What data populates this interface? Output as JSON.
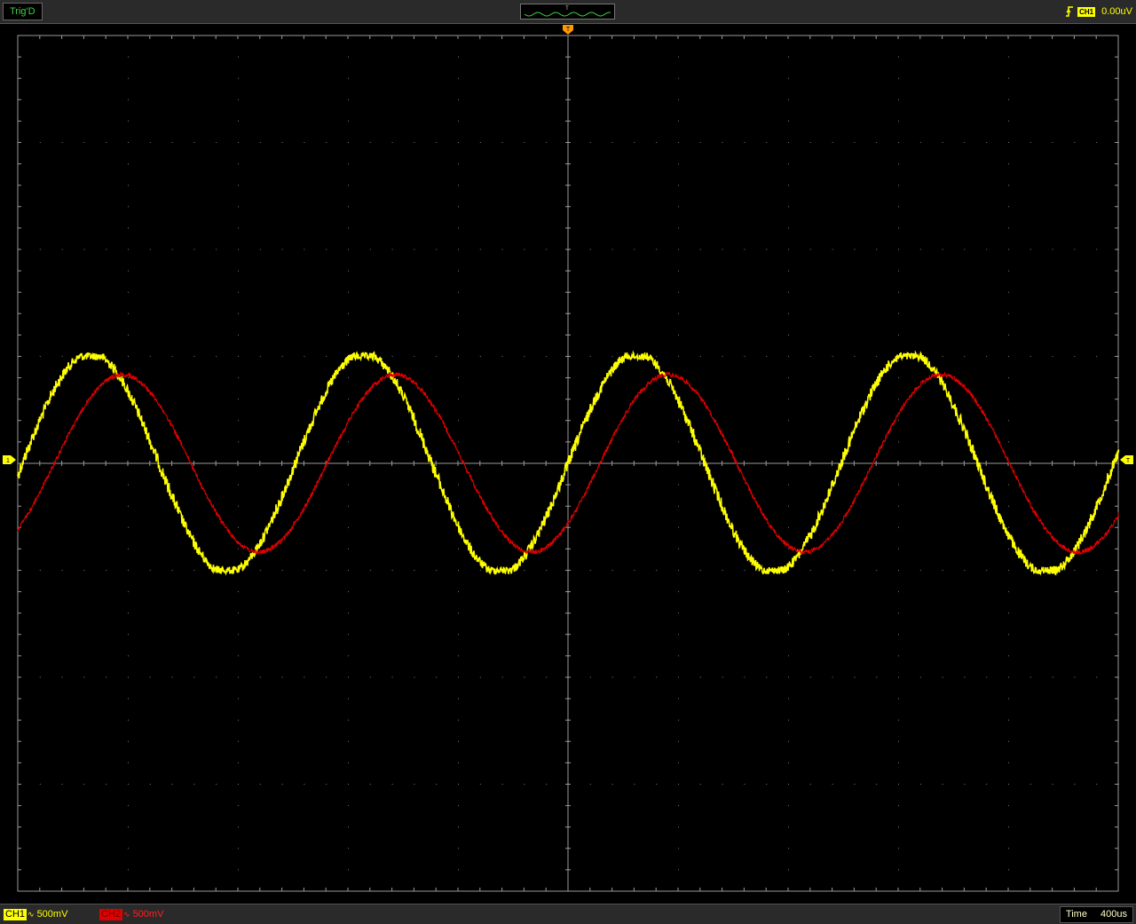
{
  "status": {
    "trigger_state": "Trig'D",
    "trigger_source": "CH1",
    "trigger_level": "0.00uV",
    "trigger_marker": "T"
  },
  "channels": [
    {
      "name": "CH1",
      "coupling": "∿",
      "scale": "500mV",
      "color": "#ffff00",
      "marker": "1"
    },
    {
      "name": "CH2",
      "coupling": "∿",
      "scale": "500mV",
      "color": "#e00000"
    }
  ],
  "timebase": {
    "label": "Time",
    "value": "400us"
  },
  "colors": {
    "grid": "#9a9a9a",
    "background": "#000000",
    "ch1": "#ffff00",
    "ch2": "#e00000",
    "accent": "#ff9900"
  },
  "chart_data": {
    "type": "line",
    "x_unit": "us",
    "xlim": [
      -2000,
      2000
    ],
    "ylim": [
      -4,
      4
    ],
    "divisions": {
      "x": 10,
      "y": 8
    },
    "grid": true,
    "series": [
      {
        "name": "CH1",
        "waveform": "sine",
        "amplitude_div": 1.0,
        "period_div": 2.48,
        "phase_deg": 0,
        "noise": true
      },
      {
        "name": "CH2",
        "waveform": "sine",
        "amplitude_div": 0.83,
        "period_div": 2.48,
        "phase_deg": -42,
        "noise": true
      }
    ]
  }
}
